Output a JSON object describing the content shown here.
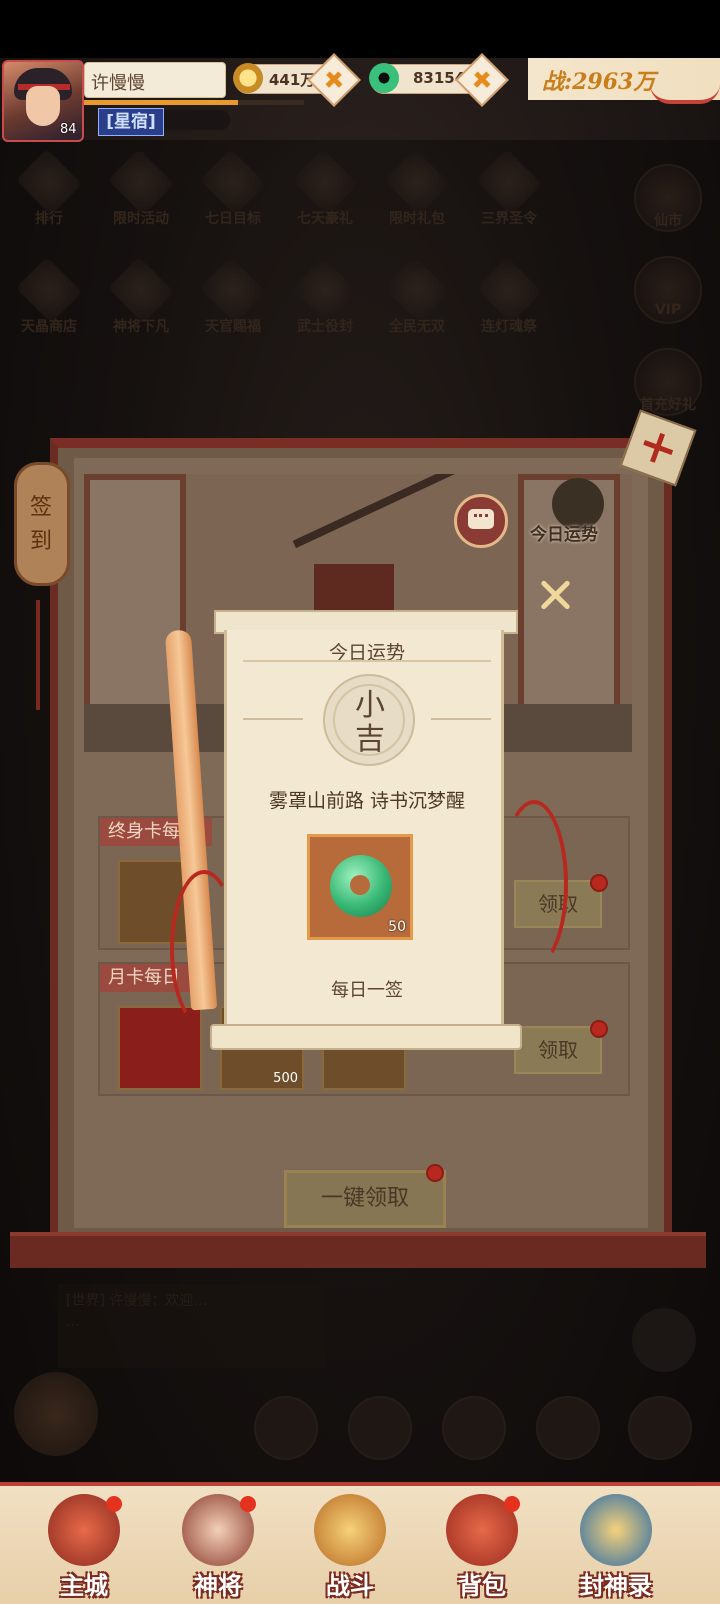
{
  "player": {
    "name": "许慢慢",
    "level": "84",
    "rank": "[星宿]",
    "xp_fraction": 0.7
  },
  "resources": {
    "gold": "441万",
    "jade": "83154",
    "power": "战:2963万"
  },
  "menu_row1": [
    "排行",
    "限时活动",
    "七日目标",
    "七天豪礼",
    "限时礼包",
    "三界圣令"
  ],
  "menu_row2": [
    "天晶商店",
    "神将下凡",
    "天官赐福",
    "武士役封",
    "全民无双",
    "连灯魂祭"
  ],
  "right_menu": [
    "仙市",
    "VIP",
    "首充好礼"
  ],
  "signin": {
    "tag": "签到",
    "fortune_button": "今日运势",
    "lifetime_card_title": "终身卡每日",
    "monthly_card_title": "月卡每日",
    "claim_label": "领取",
    "monthly_reward_count": "500",
    "one_key_claim": "一键领取"
  },
  "fortune": {
    "title": "今日运势",
    "result_char1": "小",
    "result_char2": "吉",
    "poem": "雾罩山前路  诗书沉梦醒",
    "reward_count": "50",
    "footer": "每日一签"
  },
  "chat": {
    "line1": "[世界] 许慢慢：欢迎…",
    "line2": "…"
  },
  "nav": {
    "items": [
      "主城",
      "神将",
      "战斗",
      "背包",
      "封神录"
    ]
  },
  "colors": {
    "accent_red": "#b8281e",
    "gold_text": "#c97d1b",
    "paper": "#f3e8d2"
  }
}
